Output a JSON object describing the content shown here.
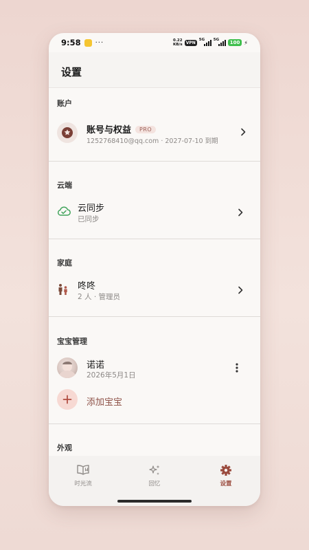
{
  "status_bar": {
    "time": "9:58",
    "net_speed_value": "0.22",
    "net_speed_unit": "KB/s",
    "vpn_label": "VPN",
    "signal_label": "5G",
    "battery": "100"
  },
  "header": {
    "title": "设置"
  },
  "sections": {
    "account": {
      "label": "账户",
      "item": {
        "title": "账号与权益",
        "badge": "PRO",
        "subtitle": "1252768410@qq.com · 2027-07-10 到期",
        "icon": "star-badge-icon"
      }
    },
    "cloud": {
      "label": "云端",
      "item": {
        "title": "云同步",
        "subtitle": "已同步",
        "icon": "cloud-check-icon"
      }
    },
    "family": {
      "label": "家庭",
      "item": {
        "title": "咚咚",
        "subtitle": "2 人 · 管理员",
        "icon": "family-icon"
      }
    },
    "babies": {
      "label": "宝宝管理",
      "item": {
        "title": "诺诺",
        "subtitle": "2026年5月1日"
      },
      "add_label": "添加宝宝"
    },
    "appearance": {
      "label": "外观"
    }
  },
  "tabbar": {
    "tabs": [
      {
        "label": "时光流",
        "icon": "book-icon",
        "active": false
      },
      {
        "label": "回忆",
        "icon": "sparkle-icon",
        "active": false
      },
      {
        "label": "设置",
        "icon": "gear-icon",
        "active": true
      }
    ]
  },
  "colors": {
    "accent": "#9b4c3f",
    "green": "#3fa35a",
    "background": "#faf8f6"
  }
}
